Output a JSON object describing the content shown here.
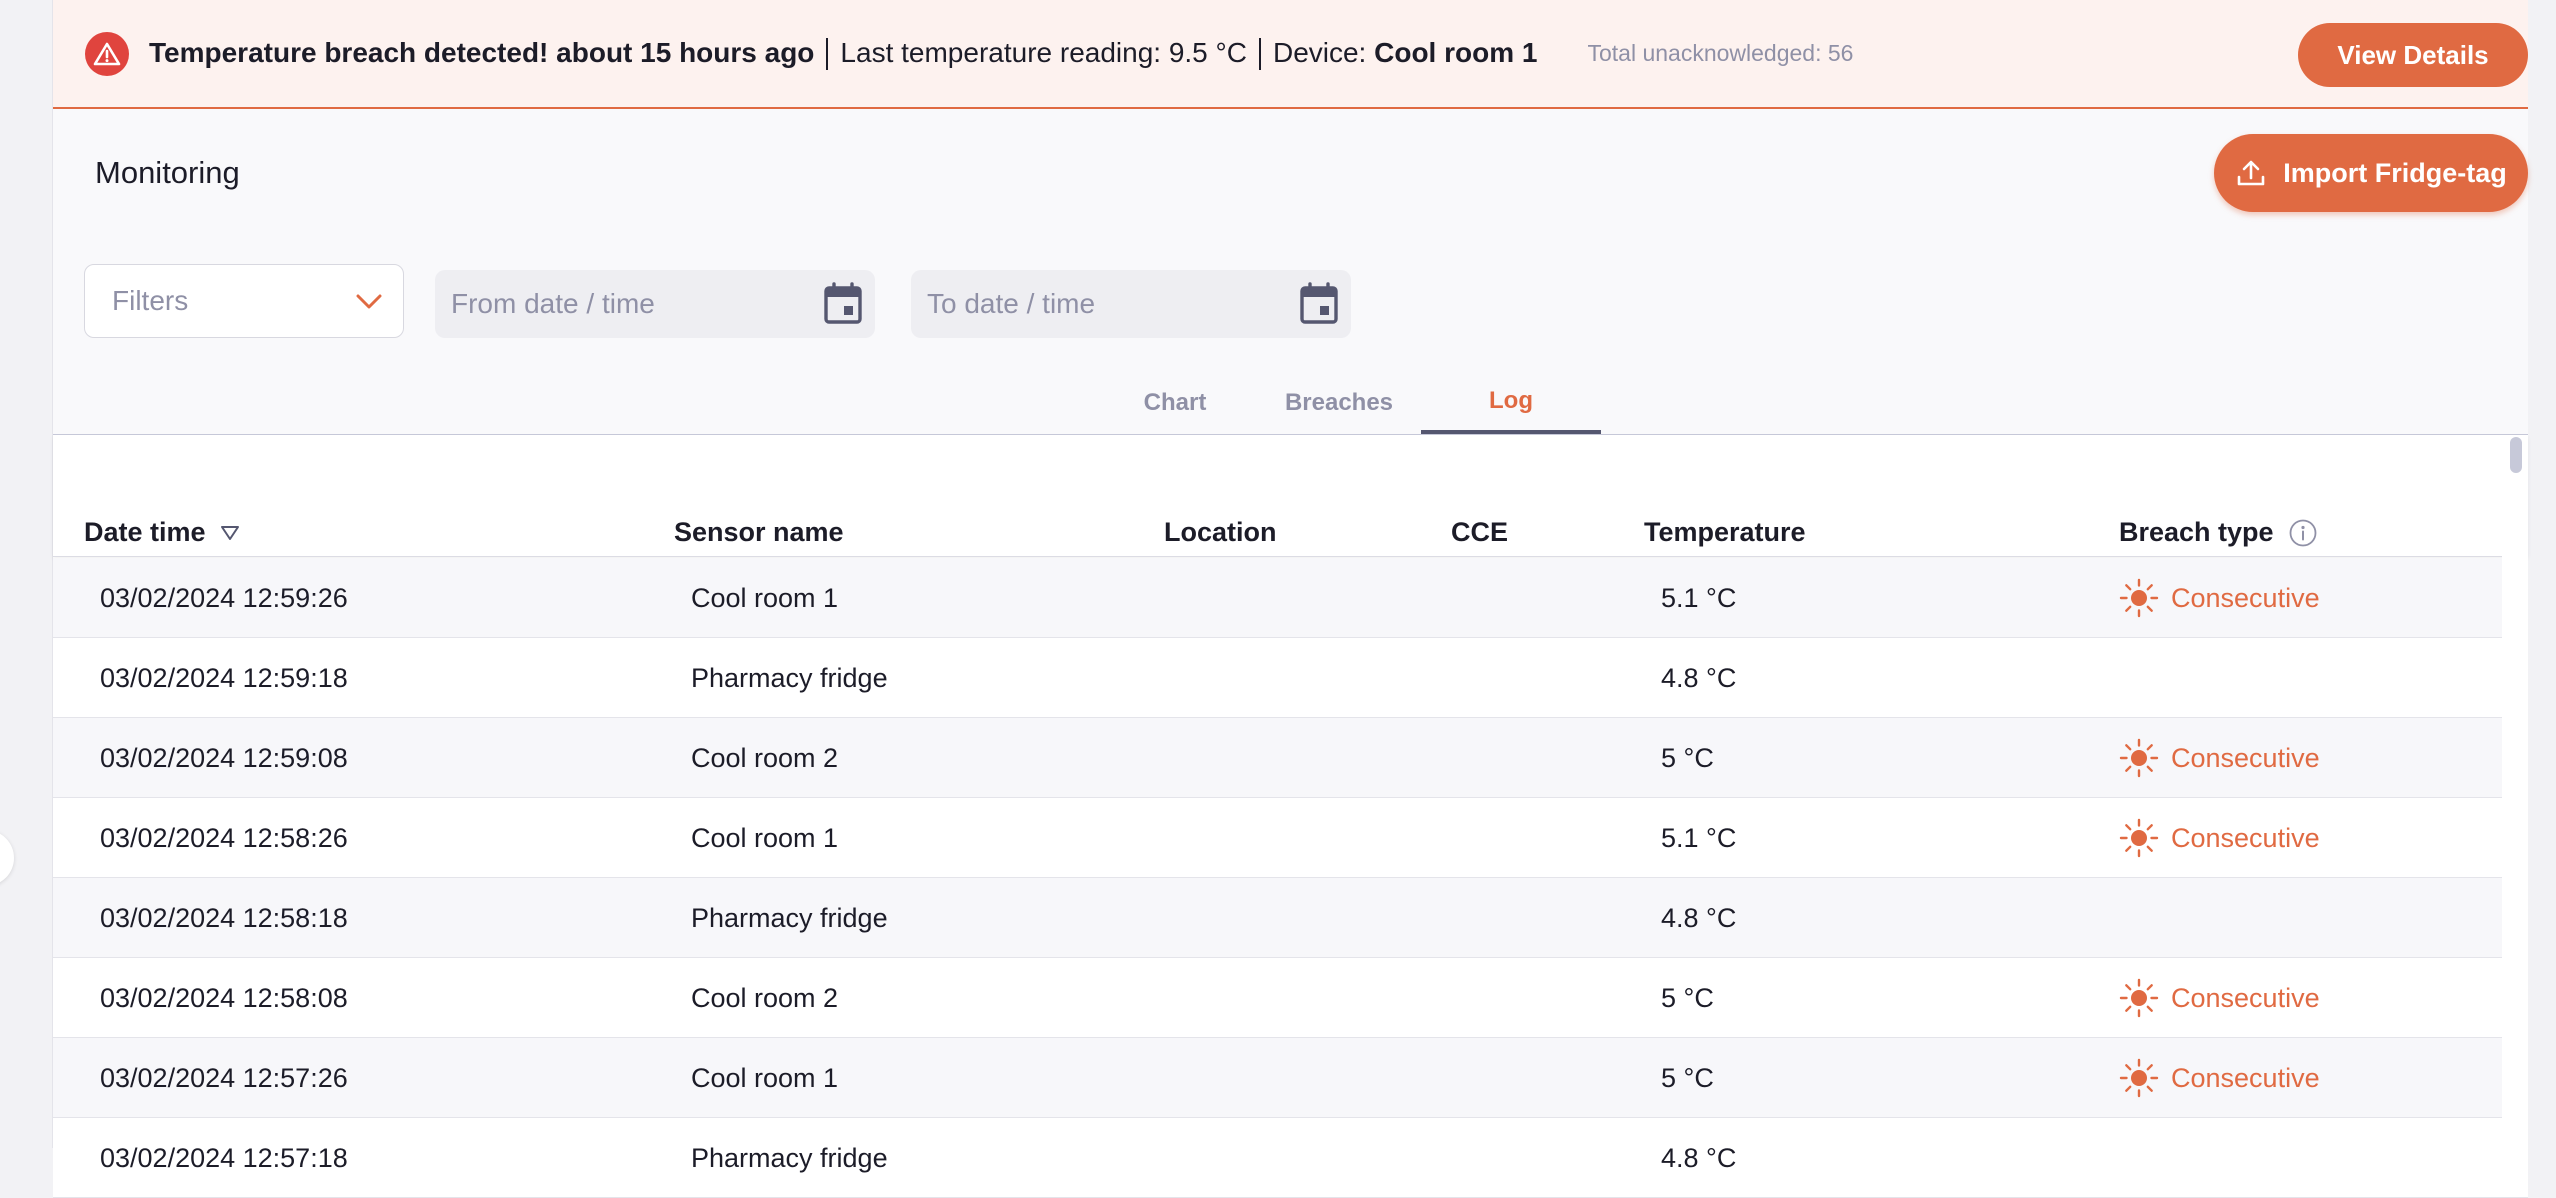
{
  "alert": {
    "title": "Temperature breach detected! about 15 hours ago",
    "reading_label": "Last temperature reading: 9.5 °C",
    "device_label": "Device:",
    "device_name": "Cool room 1",
    "unacknowledged": "Total unacknowledged: 56",
    "button": "View Details"
  },
  "header": {
    "title": "Monitoring",
    "import_button": "Import Fridge-tag"
  },
  "filters": {
    "placeholder": "Filters",
    "from_placeholder": "From date / time",
    "to_placeholder": "To date / time"
  },
  "tabs": [
    "Chart",
    "Breaches",
    "Log"
  ],
  "active_tab": "Log",
  "table": {
    "columns": [
      "Date time",
      "Sensor name",
      "Location",
      "CCE",
      "Temperature",
      "Breach type"
    ],
    "rows": [
      {
        "date": "03/02/2024 12:59:26",
        "sensor": "Cool room 1",
        "temp": "5.1 °C",
        "breach": "Consecutive"
      },
      {
        "date": "03/02/2024 12:59:18",
        "sensor": "Pharmacy fridge",
        "temp": "4.8 °C",
        "breach": ""
      },
      {
        "date": "03/02/2024 12:59:08",
        "sensor": "Cool room 2",
        "temp": "5 °C",
        "breach": "Consecutive"
      },
      {
        "date": "03/02/2024 12:58:26",
        "sensor": "Cool room 1",
        "temp": "5.1 °C",
        "breach": "Consecutive"
      },
      {
        "date": "03/02/2024 12:58:18",
        "sensor": "Pharmacy fridge",
        "temp": "4.8 °C",
        "breach": ""
      },
      {
        "date": "03/02/2024 12:58:08",
        "sensor": "Cool room 2",
        "temp": "5 °C",
        "breach": "Consecutive"
      },
      {
        "date": "03/02/2024 12:57:26",
        "sensor": "Cool room 1",
        "temp": "5 °C",
        "breach": "Consecutive"
      },
      {
        "date": "03/02/2024 12:57:18",
        "sensor": "Pharmacy fridge",
        "temp": "4.8 °C",
        "breach": ""
      }
    ]
  },
  "colors": {
    "accent": "#e06a42",
    "alert_icon": "#e0443e",
    "muted_text": "#8f90a6"
  },
  "icons": {
    "alert": "warning-triangle-icon",
    "import": "upload-icon",
    "filters": "chevron-down-icon",
    "date": "calendar-icon",
    "sort": "sort-descending-icon",
    "info": "info-icon",
    "breach": "sun-icon"
  }
}
